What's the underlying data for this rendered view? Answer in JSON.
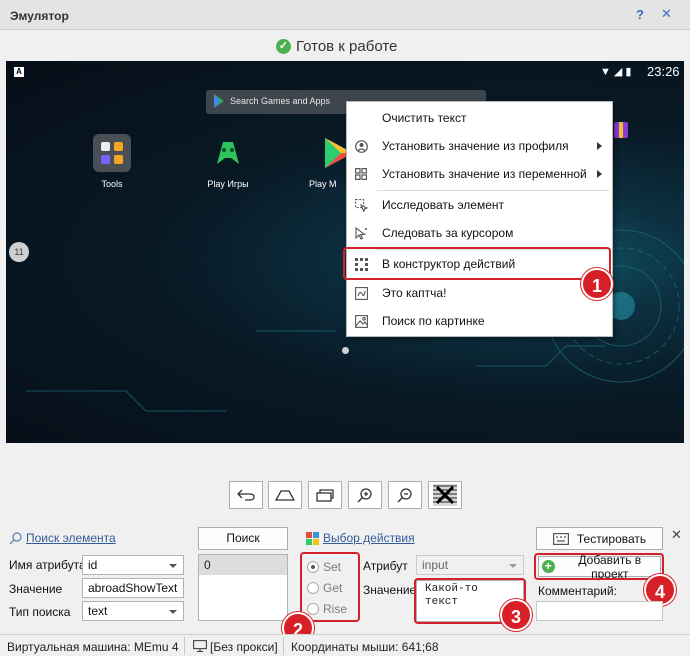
{
  "window": {
    "title": "Эмулятор",
    "help": "?",
    "close": "✕"
  },
  "status": {
    "text": "Готов к работе"
  },
  "android": {
    "clock": "23:26",
    "search_placeholder": "Search Games and Apps",
    "apps": [
      {
        "label": "Tools"
      },
      {
        "label": "Play Игры"
      },
      {
        "label": "Play M"
      }
    ],
    "volume_badge": "11"
  },
  "context_menu": {
    "items": [
      {
        "label": "Очистить текст",
        "icon": "none"
      },
      {
        "label": "Установить значение из профиля",
        "icon": "profile-icon",
        "submenu": true
      },
      {
        "label": "Установить значение из переменной",
        "icon": "grid-icon",
        "submenu": true
      },
      {
        "label": "Исследовать элемент",
        "icon": "inspect-icon"
      },
      {
        "label": "Следовать за курсором",
        "icon": "cursor-follow-icon"
      },
      {
        "label": "В конструктор действий",
        "icon": "constructor-icon"
      },
      {
        "label": "Это каптча!",
        "icon": "captcha-icon"
      },
      {
        "label": "Поиск по картинке",
        "icon": "image-search-icon"
      }
    ]
  },
  "callouts": [
    "1",
    "2",
    "3",
    "4"
  ],
  "panel": {
    "search_link": "Поиск элемента",
    "attr_name_label": "Имя атрибута",
    "attr_name_value": "id",
    "value_label": "Значение",
    "value_value": "abroadShowText",
    "search_type_label": "Тип поиска",
    "search_type_value": "text",
    "search_button": "Поиск",
    "results": [
      "0"
    ],
    "action_link": "Выбор действия",
    "radios": [
      "Set",
      "Get",
      "Rise"
    ],
    "attribute_label": "Атрибут",
    "attribute_value": "input",
    "value2_label": "Значение",
    "value2_text": "Какой-то\nтекст",
    "test_button": "Тестировать",
    "add_button": "Добавить в проект",
    "comment_label": "Комментарий:",
    "close": "✕"
  },
  "statusbar": {
    "vm": "Виртуальная машина: MEmu 4",
    "proxy": "[Без прокси]",
    "mouse": "Координаты мыши: 641;68"
  },
  "colors": {
    "accent_red": "#d71f28",
    "link": "#335c9a",
    "ok_green": "#4caf50"
  }
}
